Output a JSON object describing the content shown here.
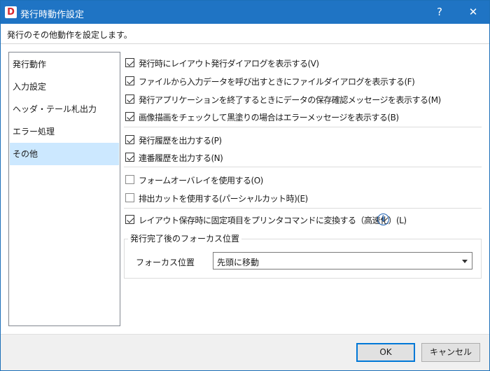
{
  "window": {
    "title": "発行時動作設定",
    "help_symbol": "?",
    "close_symbol": "✕"
  },
  "description": "発行のその他動作を設定します。",
  "nav": {
    "items": [
      {
        "label": "発行動作",
        "selected": false
      },
      {
        "label": "入力設定",
        "selected": false
      },
      {
        "label": "ヘッダ・テール札出力",
        "selected": false
      },
      {
        "label": "エラー処理",
        "selected": false
      },
      {
        "label": "その他",
        "selected": true
      }
    ]
  },
  "options": [
    {
      "label": "発行時にレイアウト発行ダイアログを表示する(V)",
      "checked": true
    },
    {
      "label": "ファイルから入力データを呼び出すときにファイルダイアログを表示する(F)",
      "checked": true
    },
    {
      "label": "発行アプリケーションを終了するときにデータの保存確認メッセージを表示する(M)",
      "checked": true
    },
    {
      "label": "画像描画をチェックして黒塗りの場合はエラーメッセージを表示する(B)",
      "checked": true
    },
    {
      "label": "発行履歴を出力する(P)",
      "checked": true
    },
    {
      "label": "連番履歴を出力する(N)",
      "checked": true
    },
    {
      "label": "フォームオーバレイを使用する(O)",
      "checked": false
    },
    {
      "label": "排出カットを使用する(パーシャルカット時)(E)",
      "checked": false
    },
    {
      "label": "レイアウト保存時に固定項目をプリンタコマンドに変換する（高速化）(L)",
      "checked": true
    }
  ],
  "info_icon": "info-icon",
  "info_glyph": "i",
  "focus_group": {
    "legend": "発行完了後のフォーカス位置",
    "label": "フォーカス位置",
    "value": "先頭に移動"
  },
  "buttons": {
    "ok": "OK",
    "cancel": "キャンセル"
  },
  "colors": {
    "titlebar": "#1f74c4",
    "selection": "#cce8ff",
    "default_button_border": "#0078d7"
  }
}
